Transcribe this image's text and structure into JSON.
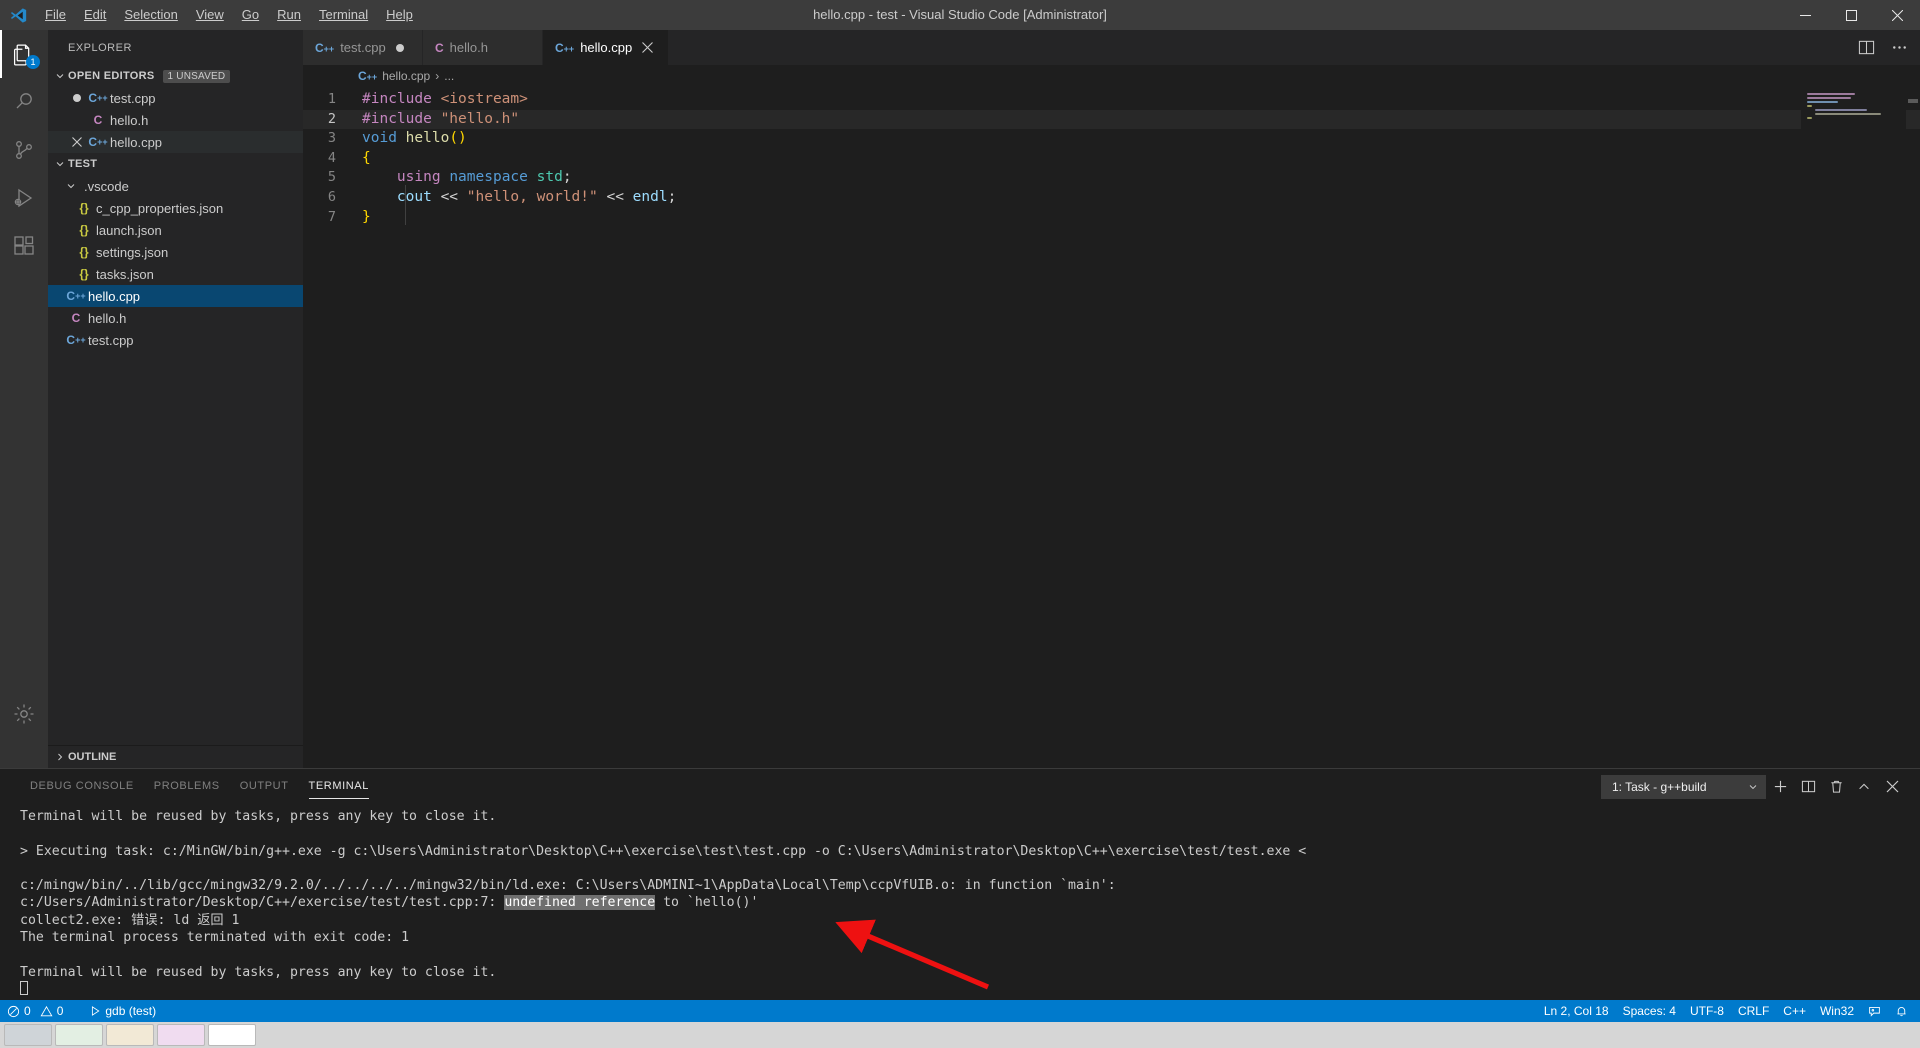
{
  "titlebar": {
    "logo_icon": "vscode-logo-icon",
    "title": "hello.cpp - test - Visual Studio Code [Administrator]",
    "menus": [
      {
        "label": "File"
      },
      {
        "label": "Edit"
      },
      {
        "label": "Selection"
      },
      {
        "label": "View"
      },
      {
        "label": "Go"
      },
      {
        "label": "Run"
      },
      {
        "label": "Terminal"
      },
      {
        "label": "Help"
      }
    ],
    "window_controls": [
      {
        "name": "minimize-button",
        "glyph": "─"
      },
      {
        "name": "maximize-button",
        "glyph": "☐"
      },
      {
        "name": "close-button",
        "glyph": "✕"
      }
    ]
  },
  "activitybar": {
    "items": [
      {
        "name": "explorer",
        "icon": "files-icon",
        "active": true,
        "badge": "1"
      },
      {
        "name": "search",
        "icon": "search-icon",
        "active": false,
        "badge": ""
      },
      {
        "name": "source-control",
        "icon": "source-control-icon",
        "active": false,
        "badge": ""
      },
      {
        "name": "run-and-debug",
        "icon": "run-debug-icon",
        "active": false,
        "badge": ""
      },
      {
        "name": "extensions",
        "icon": "extensions-icon",
        "active": false,
        "badge": ""
      }
    ],
    "bottom": [
      {
        "name": "manage",
        "icon": "gear-icon"
      }
    ]
  },
  "sidebar": {
    "title": "EXPLORER",
    "open_editors": {
      "label": "OPEN EDITORS",
      "badge": "1 UNSAVED",
      "items": [
        {
          "name": "open-editor-test-cpp",
          "label": "test.cpp",
          "icon": "cpp-icon",
          "state": "dirty",
          "selected": false
        },
        {
          "name": "open-editor-hello-h",
          "label": "hello.h",
          "icon": "h-icon",
          "state": "none",
          "selected": false
        },
        {
          "name": "open-editor-hello-cpp",
          "label": "hello.cpp",
          "icon": "cpp-icon",
          "state": "close",
          "selected": false,
          "hovered": true
        }
      ]
    },
    "workspace": {
      "label": "TEST",
      "items": [
        {
          "name": "folder-vscode",
          "label": ".vscode",
          "icon": "folder-open-icon",
          "indent": 1,
          "selected": false
        },
        {
          "name": "file-c-cpp-properties-json",
          "label": "c_cpp_properties.json",
          "icon": "json-icon",
          "indent": 2,
          "selected": false
        },
        {
          "name": "file-launch-json",
          "label": "launch.json",
          "icon": "json-icon",
          "indent": 2,
          "selected": false
        },
        {
          "name": "file-settings-json",
          "label": "settings.json",
          "icon": "json-icon",
          "indent": 2,
          "selected": false
        },
        {
          "name": "file-tasks-json",
          "label": "tasks.json",
          "icon": "json-icon",
          "indent": 2,
          "selected": false
        },
        {
          "name": "file-hello-cpp",
          "label": "hello.cpp",
          "icon": "cpp-icon",
          "indent": 1,
          "selected": true
        },
        {
          "name": "file-hello-h",
          "label": "hello.h",
          "icon": "h-icon",
          "indent": 1,
          "selected": false
        },
        {
          "name": "file-test-cpp",
          "label": "test.cpp",
          "icon": "cpp-icon",
          "indent": 1,
          "selected": false
        }
      ]
    },
    "outline": {
      "label": "OUTLINE"
    }
  },
  "tabs": [
    {
      "name": "tab-test-cpp",
      "label": "test.cpp",
      "icon": "cpp-icon",
      "active": false,
      "dirty": true
    },
    {
      "name": "tab-hello-h",
      "label": "hello.h",
      "icon": "h-icon",
      "active": false,
      "dirty": false
    },
    {
      "name": "tab-hello-cpp",
      "label": "hello.cpp",
      "icon": "cpp-icon",
      "active": true,
      "dirty": false
    }
  ],
  "editor_actions": [
    {
      "name": "split-editor-button",
      "icon": "split-editor-icon"
    },
    {
      "name": "more-actions-button",
      "icon": "ellipsis-icon"
    }
  ],
  "breadcrumb": {
    "file": "hello.cpp",
    "separator": "›",
    "tail": "..."
  },
  "code": {
    "language": "cpp",
    "lines": [
      {
        "n": "1",
        "text": "#include <iostream>"
      },
      {
        "n": "2",
        "text": "#include \"hello.h\"",
        "current": true
      },
      {
        "n": "3",
        "text": "void hello()"
      },
      {
        "n": "4",
        "text": "{"
      },
      {
        "n": "5",
        "text": "    using namespace std;"
      },
      {
        "n": "6",
        "text": "    cout << \"hello, world!\" << endl;"
      },
      {
        "n": "7",
        "text": "}"
      }
    ]
  },
  "panel": {
    "tabs": [
      {
        "name": "panel-tab-debug-console",
        "label": "DEBUG CONSOLE",
        "active": false
      },
      {
        "name": "panel-tab-problems",
        "label": "PROBLEMS",
        "active": false
      },
      {
        "name": "panel-tab-output",
        "label": "OUTPUT",
        "active": false
      },
      {
        "name": "panel-tab-terminal",
        "label": "TERMINAL",
        "active": true
      }
    ],
    "terminal_selector": {
      "value": "1: Task - g++build",
      "chevron": "⌄"
    },
    "actions": [
      {
        "name": "new-terminal-button",
        "icon": "plus-icon",
        "glyph": "+"
      },
      {
        "name": "split-terminal-button",
        "icon": "split-icon",
        "glyph": "◫"
      },
      {
        "name": "kill-terminal-button",
        "icon": "trash-icon",
        "glyph": "Ὕ1"
      },
      {
        "name": "maximize-panel-button",
        "icon": "chevron-up-icon",
        "glyph": "∧"
      },
      {
        "name": "close-panel-button",
        "icon": "close-icon",
        "glyph": "✕"
      }
    ],
    "terminal_lines": [
      {
        "text": "Terminal will be reused by tasks, press any key to close it."
      },
      {
        "text": ""
      },
      {
        "text": "> Executing task: c:/MinGW/bin/g++.exe -g c:\\Users\\Administrator\\Desktop\\C++\\exercise\\test\\test.cpp -o C:\\Users\\Administrator\\Desktop\\C++\\exercise\\test/test.exe <"
      },
      {
        "text": ""
      },
      {
        "text": "c:/mingw/bin/../lib/gcc/mingw32/9.2.0/../../../../mingw32/bin/ld.exe: C:\\Users\\ADMINI~1\\AppData\\Local\\Temp\\ccpVfUIB.o: in function `main':"
      },
      {
        "text": "c:/Users/Administrator/Desktop/C++/exercise/test/test.cpp:7: ",
        "highlight": "undefined reference",
        "after": " to `hello()'"
      },
      {
        "text": "collect2.exe: 错误: ld 返回 1"
      },
      {
        "text": "The terminal process terminated with exit code: 1"
      },
      {
        "text": ""
      },
      {
        "text": "Terminal will be reused by tasks, press any key to close it."
      },
      {
        "text": "",
        "cursor": true
      }
    ]
  },
  "statusbar": {
    "left": [
      {
        "name": "status-remote-problems",
        "icon": "error-warning-icon",
        "label": "0 ⚠ 0",
        "error_glyph": "⊗",
        "warn_glyph": "⚠"
      },
      {
        "name": "status-run-gdb",
        "icon": "play-icon",
        "label": "gdb (test)",
        "glyph": "▷"
      }
    ],
    "right": [
      {
        "name": "status-cursor-position",
        "label": "Ln 2, Col 18"
      },
      {
        "name": "status-indentation",
        "label": "Spaces: 4"
      },
      {
        "name": "status-encoding",
        "label": "UTF-8"
      },
      {
        "name": "status-eol",
        "label": "CRLF"
      },
      {
        "name": "status-language-mode",
        "label": "C++"
      },
      {
        "name": "status-platform",
        "label": "Win32"
      },
      {
        "name": "status-feedback",
        "label": "",
        "icon": "feedback-icon"
      },
      {
        "name": "status-notifications",
        "label": "",
        "icon": "bell-icon"
      }
    ]
  },
  "annotation": {
    "type": "red-arrow",
    "color": "#ee1111"
  },
  "colors": {
    "accent": "#007acc",
    "selected_row": "#094771",
    "editor_bg": "#1e1e1e",
    "sidebar_bg": "#252526",
    "activitybar_bg": "#333333",
    "titlebar_bg": "#3c3c3c"
  }
}
